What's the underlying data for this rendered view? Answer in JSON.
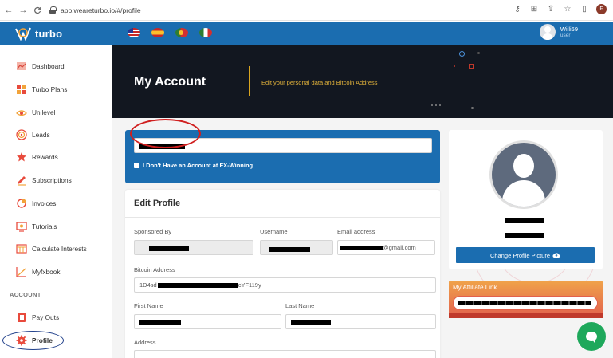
{
  "browser": {
    "url": "app.weareturbo.io/#/profile",
    "back_icon": "←",
    "forward_icon": "→",
    "reload_icon": "C",
    "profile_letter": "F"
  },
  "header": {
    "logo_text": "turbo",
    "user_name": "Willi69",
    "user_role": "user",
    "flags": [
      "us",
      "es",
      "pt",
      "it"
    ]
  },
  "sidebar": {
    "items": [
      {
        "label": "Dashboard",
        "icon": "dashboard-icon"
      },
      {
        "label": "Turbo Plans",
        "icon": "plans-icon"
      },
      {
        "label": "Unilevel",
        "icon": "unilevel-icon"
      },
      {
        "label": "Leads",
        "icon": "leads-icon"
      },
      {
        "label": "Rewards",
        "icon": "rewards-icon"
      },
      {
        "label": "Subscriptions",
        "icon": "pencil-icon"
      },
      {
        "label": "Invoices",
        "icon": "invoice-icon"
      },
      {
        "label": "Tutorials",
        "icon": "tutorials-icon"
      },
      {
        "label": "Calculate Interests",
        "icon": "calculator-icon"
      },
      {
        "label": "Myfxbook",
        "icon": "chart-icon"
      }
    ],
    "section_label": "ACCOUNT",
    "account_items": [
      {
        "label": "Pay Outs",
        "icon": "payout-icon"
      },
      {
        "label": "Profile",
        "icon": "gear-icon"
      }
    ]
  },
  "hero": {
    "title": "My Account",
    "subtitle": "Edit your personal data and Bitcoin Address"
  },
  "fx_card": {
    "checkbox_label": "I Don't Have an Account at FX-Winning"
  },
  "form": {
    "title": "Edit Profile",
    "sponsored_by_label": "Sponsored By",
    "username_label": "Username",
    "email_label": "Email address",
    "email_value_suffix": "@gmail.com",
    "bitcoin_label": "Bitcoin Address",
    "bitcoin_prefix": "1D4sd",
    "bitcoin_suffix": "cYF119y",
    "first_name_label": "First Name",
    "last_name_label": "Last Name",
    "address_label": "Address"
  },
  "profile_card": {
    "change_button": "Change Profile Picture"
  },
  "affiliate": {
    "title": "My Affiliate Link"
  },
  "colors": {
    "brand_blue": "#1b6db0",
    "hero_gold": "#e0b13a",
    "affiliate_orange": "#f0a34a",
    "chat_green": "#1ea85b"
  }
}
